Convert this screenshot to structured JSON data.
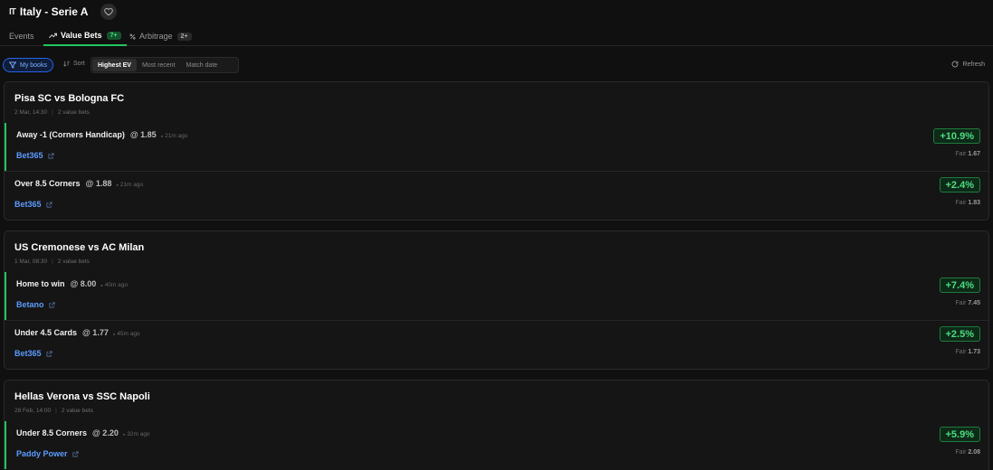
{
  "header": {
    "flag": "IT",
    "title": "Italy - Serie A"
  },
  "tabs": [
    {
      "label": "Events",
      "badge": ""
    },
    {
      "label": "Value Bets",
      "badge": "7+"
    },
    {
      "label": "Arbitrage",
      "badge": "2+"
    }
  ],
  "toolbar": {
    "mybooks": "My books",
    "sort": "Sort",
    "sort_options": [
      "Highest EV",
      "Most recent",
      "Match date"
    ],
    "refresh": "Refresh"
  },
  "fair_label": "Fair",
  "matches": [
    {
      "title": "Pisa SC vs Bologna FC",
      "date": "2 Mar, 14:30",
      "count": "2 value bets",
      "bets": [
        {
          "market": "Away -1 (Corners Handicap)",
          "odds": "@ 1.85",
          "ago": "21m ago",
          "book": "Bet365",
          "ev": "+10.9%",
          "fair": "1.67"
        },
        {
          "market": "Over 8.5 Corners",
          "odds": "@ 1.88",
          "ago": "21m ago",
          "book": "Bet365",
          "ev": "+2.4%",
          "fair": "1.83"
        }
      ]
    },
    {
      "title": "US Cremonese vs AC Milan",
      "date": "1 Mar, 08:30",
      "count": "2 value bets",
      "bets": [
        {
          "market": "Home to win",
          "odds": "@ 8.00",
          "ago": "40m ago",
          "book": "Betano",
          "ev": "+7.4%",
          "fair": "7.45"
        },
        {
          "market": "Under 4.5 Cards",
          "odds": "@ 1.77",
          "ago": "45m ago",
          "book": "Bet365",
          "ev": "+2.5%",
          "fair": "1.73"
        }
      ]
    },
    {
      "title": "Hellas Verona vs SSC Napoli",
      "date": "28 Feb, 14:00",
      "count": "2 value bets",
      "bets": [
        {
          "market": "Under 8.5 Corners",
          "odds": "@ 2.20",
          "ago": "32m ago",
          "book": "Paddy Power",
          "ev": "+5.9%",
          "fair": "2.08"
        }
      ]
    }
  ],
  "colors": {
    "accent": "#22c55e",
    "book_link": "#5b9bff",
    "background": "#101010"
  }
}
